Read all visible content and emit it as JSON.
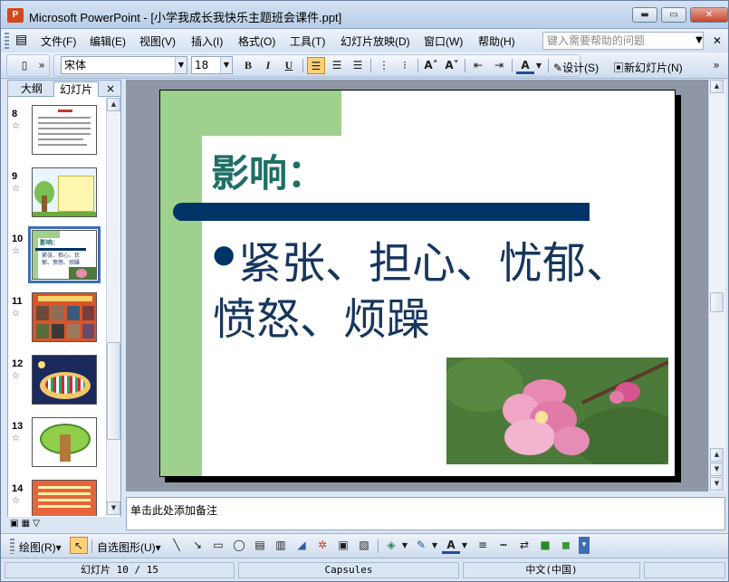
{
  "window": {
    "app_icon_text": "P",
    "title": "Microsoft PowerPoint - [小学我成长我快乐主题班会课件.ppt]",
    "buttons": {
      "minimize": "▬",
      "maximize": "▭",
      "close": "✕"
    }
  },
  "menu": {
    "items": [
      "文件(F)",
      "编辑(E)",
      "视图(V)",
      "插入(I)",
      "格式(O)",
      "工具(T)",
      "幻灯片放映(D)",
      "窗口(W)",
      "帮助(H)"
    ],
    "help_placeholder": "键入需要帮助的问题"
  },
  "toolbar": {
    "font_name": "宋体",
    "font_size": "18",
    "bold": "B",
    "italic": "I",
    "underline": "U",
    "increase_font": "A˄",
    "decrease_font": "A˅",
    "font_color": "A",
    "design_label": "设计(S)",
    "new_slide_label": "新幻灯片(N)"
  },
  "slides_pane": {
    "tab_outline": "大纲",
    "tab_slides": "幻灯片",
    "close": "×",
    "thumbnails": [
      {
        "number": "8"
      },
      {
        "number": "9"
      },
      {
        "number": "10",
        "selected": true,
        "title_text": "影响：",
        "body_text": "紧张、担心、忧郁、愤怒、烦躁"
      },
      {
        "number": "11"
      },
      {
        "number": "12"
      },
      {
        "number": "13"
      },
      {
        "number": "14"
      }
    ],
    "star": "☆"
  },
  "slide": {
    "title": "影响：",
    "bullet": "●",
    "body": "紧张、担心、忧郁、愤怒、烦躁",
    "colors": {
      "title": "#1f6f66",
      "body": "#17365d",
      "bar": "#003366",
      "band": "#9ed08e"
    }
  },
  "notes": {
    "placeholder": "单击此处添加备注"
  },
  "drawing_toolbar": {
    "draw_label": "绘图(R)",
    "autoshapes_label": "自选图形(U)"
  },
  "status": {
    "slide_position": "幻灯片 10 / 15",
    "template": "Capsules",
    "language": "中文(中国)"
  }
}
